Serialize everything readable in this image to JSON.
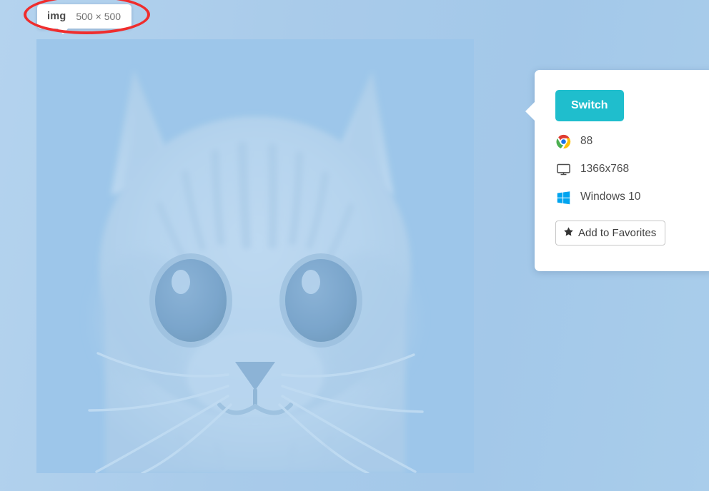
{
  "tooltip": {
    "tag": "img",
    "dimensions": "500 × 500",
    "annotation_color": "#ef2d2d"
  },
  "canvas": {
    "subject": "cat-photo",
    "overlay_color": "#96c3ea",
    "background_color": "#a9cbea"
  },
  "rail": {
    "accent_color": "#28b8c4",
    "items": [
      {
        "name": "close-button",
        "icon": "close-icon",
        "active": true,
        "size": "large"
      },
      {
        "name": "switch-button",
        "icon": "switch-icon",
        "active": true,
        "size": "small"
      },
      {
        "name": "bug-report-button",
        "icon": "bug-icon",
        "active": false,
        "size": "small"
      },
      {
        "name": "record-video-button",
        "icon": "video-camera-icon",
        "active": false,
        "size": "small"
      },
      {
        "name": "screenshots-button",
        "icon": "copy-stack-icon",
        "active": false,
        "size": "small"
      },
      {
        "name": "resolution-button",
        "icon": "monitor-resize-icon",
        "active": false,
        "size": "small"
      },
      {
        "name": "files-button",
        "icon": "folder-icon",
        "active": false,
        "size": "small"
      },
      {
        "name": "settings-button",
        "icon": "gear-icon",
        "active": false,
        "size": "small"
      },
      {
        "name": "power-button",
        "icon": "power-icon",
        "active": false,
        "size": "small"
      }
    ]
  },
  "panel": {
    "switch_label": "Switch",
    "switch_color": "#1fbecd",
    "rows": [
      {
        "icon": "chrome-icon",
        "label": "88"
      },
      {
        "icon": "monitor-icon",
        "label": "1366x768"
      },
      {
        "icon": "windows-icon",
        "label": "Windows 10"
      }
    ],
    "favorites_label": "Add to Favorites",
    "favorites_icon": "star-icon"
  }
}
